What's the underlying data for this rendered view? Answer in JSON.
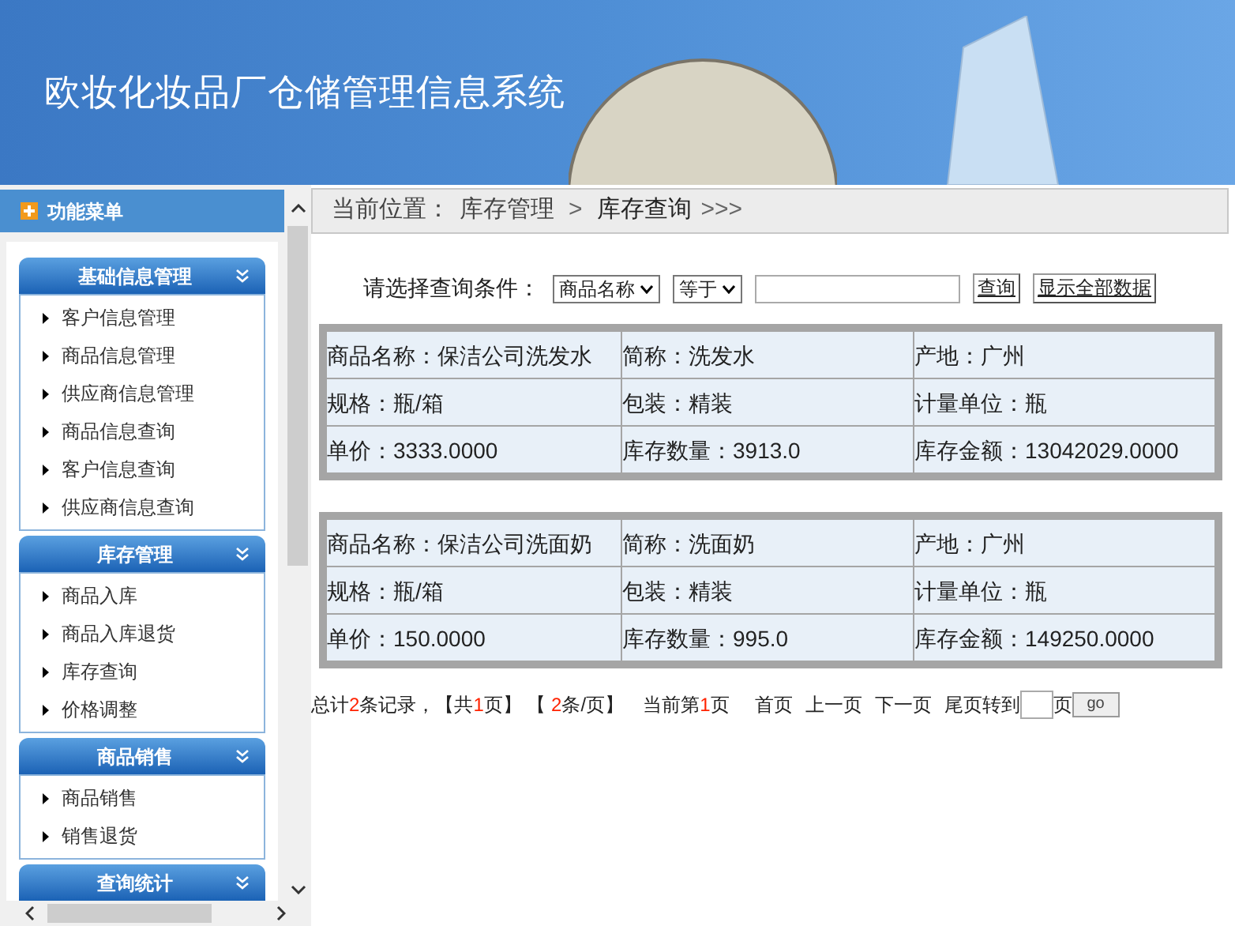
{
  "header": {
    "title": "欧妆化妆品厂仓储管理信息系统"
  },
  "sidebar": {
    "title": "功能菜单",
    "groups": [
      {
        "title": "基础信息管理",
        "expanded": true,
        "items": [
          "客户信息管理",
          "商品信息管理",
          "供应商信息管理",
          "商品信息查询",
          "客户信息查询",
          "供应商信息查询"
        ]
      },
      {
        "title": "库存管理",
        "expanded": true,
        "items": [
          "商品入库",
          "商品入库退货",
          "库存查询",
          "价格调整"
        ]
      },
      {
        "title": "商品销售",
        "expanded": true,
        "items": [
          "商品销售",
          "销售退货"
        ]
      },
      {
        "title": "查询统计",
        "expanded": true
      }
    ]
  },
  "breadcrumb": {
    "label": "当前位置：",
    "parent": "库存管理",
    "separator": ">",
    "current": "库存查询",
    "trail": ">>>"
  },
  "query": {
    "label": "请选择查询条件：",
    "field": "商品名称",
    "operator": "等于",
    "buttons": [
      "查询",
      "显示全部数据"
    ]
  },
  "records": [
    [
      [
        "商品名称：保洁公司洗发水",
        "简称：洗发水",
        "产地：广州"
      ],
      [
        "规格：瓶/箱",
        "包装：精装",
        "计量单位：瓶"
      ],
      [
        "单价：3333.0000",
        "库存数量：3913.0",
        "库存金额：13042029.0000"
      ]
    ],
    [
      [
        "商品名称：保洁公司洗面奶",
        "简称：洗面奶",
        "产地：广州"
      ],
      [
        "规格：瓶/箱",
        "包装：精装",
        "计量单位：瓶"
      ],
      [
        "单价：150.0000",
        "库存数量：995.0",
        "库存金额：149250.0000"
      ]
    ]
  ],
  "pagination": {
    "summary": [
      {
        "text": "总计",
        "highlight": false
      },
      {
        "text": "2",
        "highlight": true
      },
      {
        "text": "条记录，【共",
        "highlight": false
      },
      {
        "text": "1",
        "highlight": true
      },
      {
        "text": "页】 【 ",
        "highlight": false
      },
      {
        "text": "2",
        "highlight": true
      },
      {
        "text": "条/页】",
        "highlight": false
      }
    ],
    "current": [
      {
        "text": "当前第",
        "highlight": false
      },
      {
        "text": "1",
        "highlight": true
      },
      {
        "text": "页",
        "highlight": false
      }
    ],
    "links": [
      "首页",
      "上一页",
      "下一页",
      "尾页"
    ],
    "goto_label": "转到",
    "page_suffix": "页",
    "go": "go"
  }
}
